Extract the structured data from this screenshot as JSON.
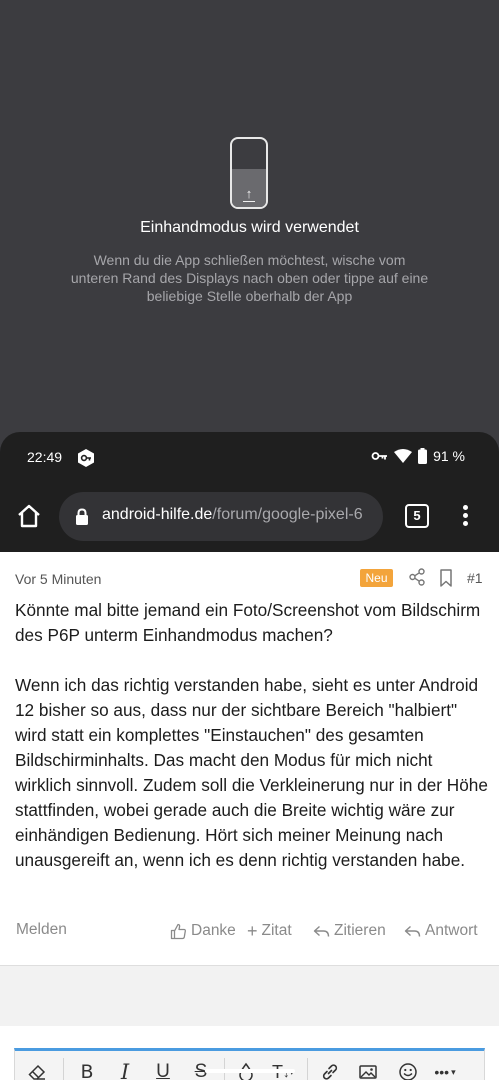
{
  "one_handed": {
    "title": "Einhandmodus wird verwendet",
    "description": "Wenn du die App schließen möchtest, wische vom unteren Rand des Displays nach oben oder tippe auf eine beliebige Stelle oberhalb der App",
    "icon": "phone-swipe-up-icon"
  },
  "status_bar": {
    "time": "22:49",
    "battery": "91 %",
    "icons": [
      "app-badge-icon",
      "vpn-key-icon",
      "wifi-icon",
      "battery-icon"
    ]
  },
  "browser": {
    "url_domain": "android-hilfe.de",
    "url_path": "/forum/google-pixel-6",
    "tab_count": "5"
  },
  "post": {
    "time": "Vor 5 Minuten",
    "badge": "Neu",
    "number": "#1",
    "paragraphs": [
      "Könnte mal bitte jemand ein Foto/Screenshot vom Bildschirm des P6P unterm Einhandmodus machen?",
      "Wenn ich das richtig verstanden habe, sieht es unter Android 12 bisher so aus, dass nur der sichtbare Bereich \"halbiert\" wird statt ein komplettes \"Einstauchen\" des gesamten Bildschirminhalts. Das macht den Modus für mich nicht wirklich sinnvoll. Zudem soll die Verkleinerung nur in der Höhe stattfinden, wobei gerade auch die Breite wichtig wäre zur einhändigen Bedienung. Hört sich meiner Meinung nach unausgereift an, wenn ich es denn richtig verstanden habe."
    ],
    "actions": {
      "report": "Melden",
      "thanks": "Danke",
      "quote": "Zitat",
      "cite": "Zitieren",
      "reply": "Antwort"
    }
  },
  "colors": {
    "overlay_bg": "#3c3c40",
    "chrome_bg": "#1f1f1f",
    "badge_new": "#f3a43b",
    "editor_accent": "#4a9be0"
  }
}
